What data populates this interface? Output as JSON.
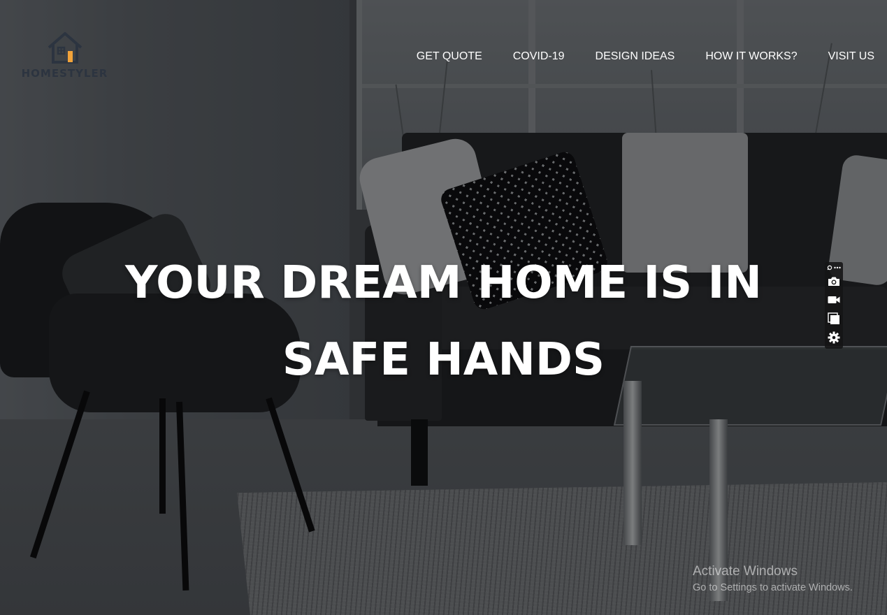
{
  "brand": {
    "name": "HOMESTYLER"
  },
  "nav": {
    "items": [
      {
        "label": "GET QUOTE"
      },
      {
        "label": "COVID-19"
      },
      {
        "label": "DESIGN IDEAS"
      },
      {
        "label": "HOW IT WORKS?"
      },
      {
        "label": "VISIT US"
      }
    ]
  },
  "hero": {
    "line1": "YOUR DREAM HOME IS IN",
    "line2": "SAFE HANDS"
  },
  "capture_toolbar": {
    "buttons": [
      {
        "icon": "camera-icon"
      },
      {
        "icon": "video-camera-icon"
      },
      {
        "icon": "window-capture-icon"
      },
      {
        "icon": "gear-icon"
      }
    ]
  },
  "watermark": {
    "title": "Activate Windows",
    "subtitle": "Go to Settings to activate Windows."
  },
  "colors": {
    "logo_dark": "#2c3440",
    "logo_accent": "#f2a33a",
    "nav_text": "#ffffff",
    "hero_text": "#ffffff"
  }
}
